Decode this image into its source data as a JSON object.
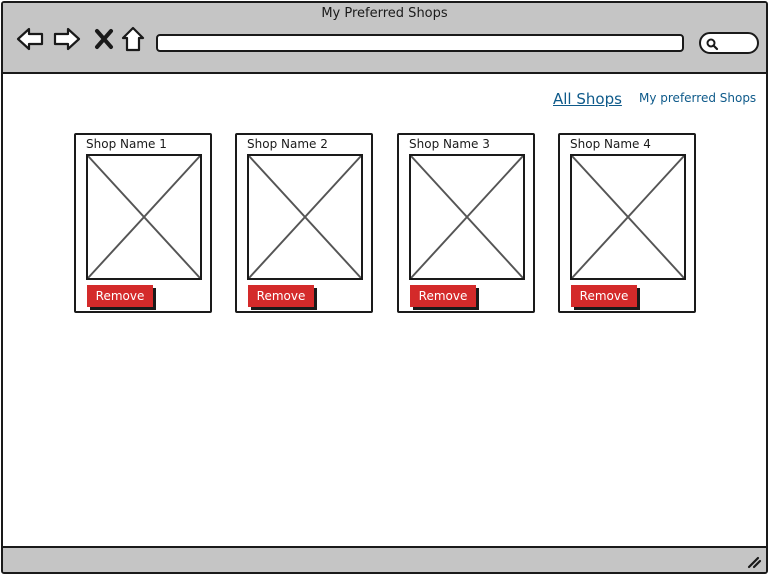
{
  "window": {
    "title": "My Preferred Shops"
  },
  "toolbar": {
    "back_icon": "back-arrow-icon",
    "forward_icon": "forward-arrow-icon",
    "stop_icon": "close-icon",
    "home_icon": "home-icon",
    "address_value": "",
    "search_icon": "search-icon"
  },
  "nav": {
    "all_shops": "All Shops",
    "preferred_shops": "My preferred Shops"
  },
  "shops": [
    {
      "name": "Shop Name 1",
      "action": "Remove"
    },
    {
      "name": "Shop Name 2",
      "action": "Remove"
    },
    {
      "name": "Shop Name 3",
      "action": "Remove"
    },
    {
      "name": "Shop Name 4",
      "action": "Remove"
    }
  ],
  "colors": {
    "chrome": "#c5c5c5",
    "link": "#0e5a8a",
    "remove_button": "#d42a2a"
  }
}
